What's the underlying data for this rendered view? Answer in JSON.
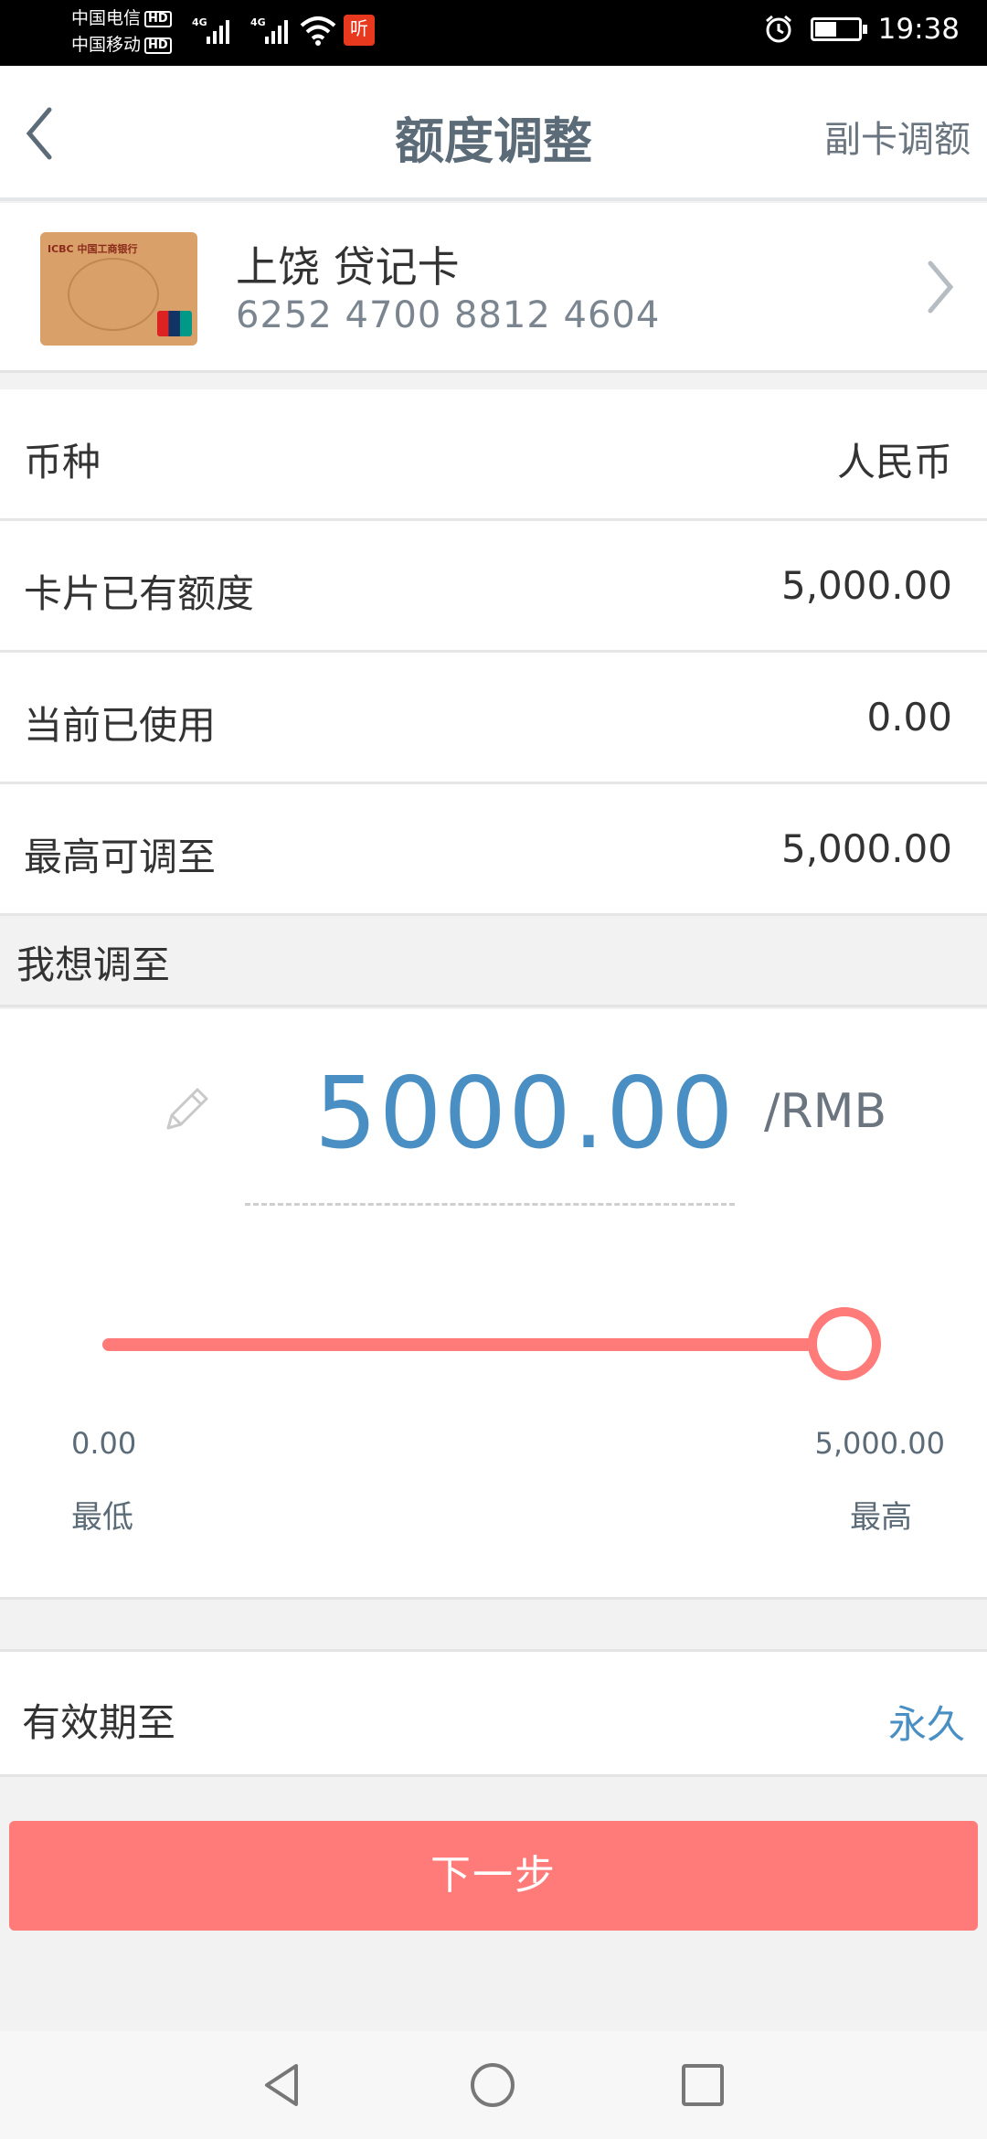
{
  "status_bar": {
    "carrier1": "中国电信",
    "carrier2": "中国移动",
    "hd_badge": "HD",
    "net1": "4G",
    "net2": "4G",
    "app_icon_text": "听",
    "time": "19:38"
  },
  "header": {
    "title": "额度调整",
    "action": "副卡调额"
  },
  "card": {
    "bank_label": "ICBC 中国工商银行",
    "name": "上饶 贷记卡",
    "number": "6252 4700 8812 4604"
  },
  "info_rows": [
    {
      "label": "币种",
      "value": "人民币"
    },
    {
      "label": "卡片已有额度",
      "value": "5,000.00"
    },
    {
      "label": "当前已使用",
      "value": "0.00"
    },
    {
      "label": "最高可调至",
      "value": "5,000.00"
    }
  ],
  "adjust": {
    "section_label": "我想调至",
    "amount": "5000.00",
    "unit": "/RMB",
    "slider": {
      "min_value": "0.00",
      "max_value": "5,000.00",
      "min_label": "最低",
      "max_label": "最高",
      "position_fraction": 1.0
    }
  },
  "validity": {
    "label": "有效期至",
    "value": "永久"
  },
  "next_button": "下一步",
  "colors": {
    "accent": "#ff7b79",
    "amount_blue": "#4a8fc4",
    "title_gray": "#5c6b78"
  }
}
